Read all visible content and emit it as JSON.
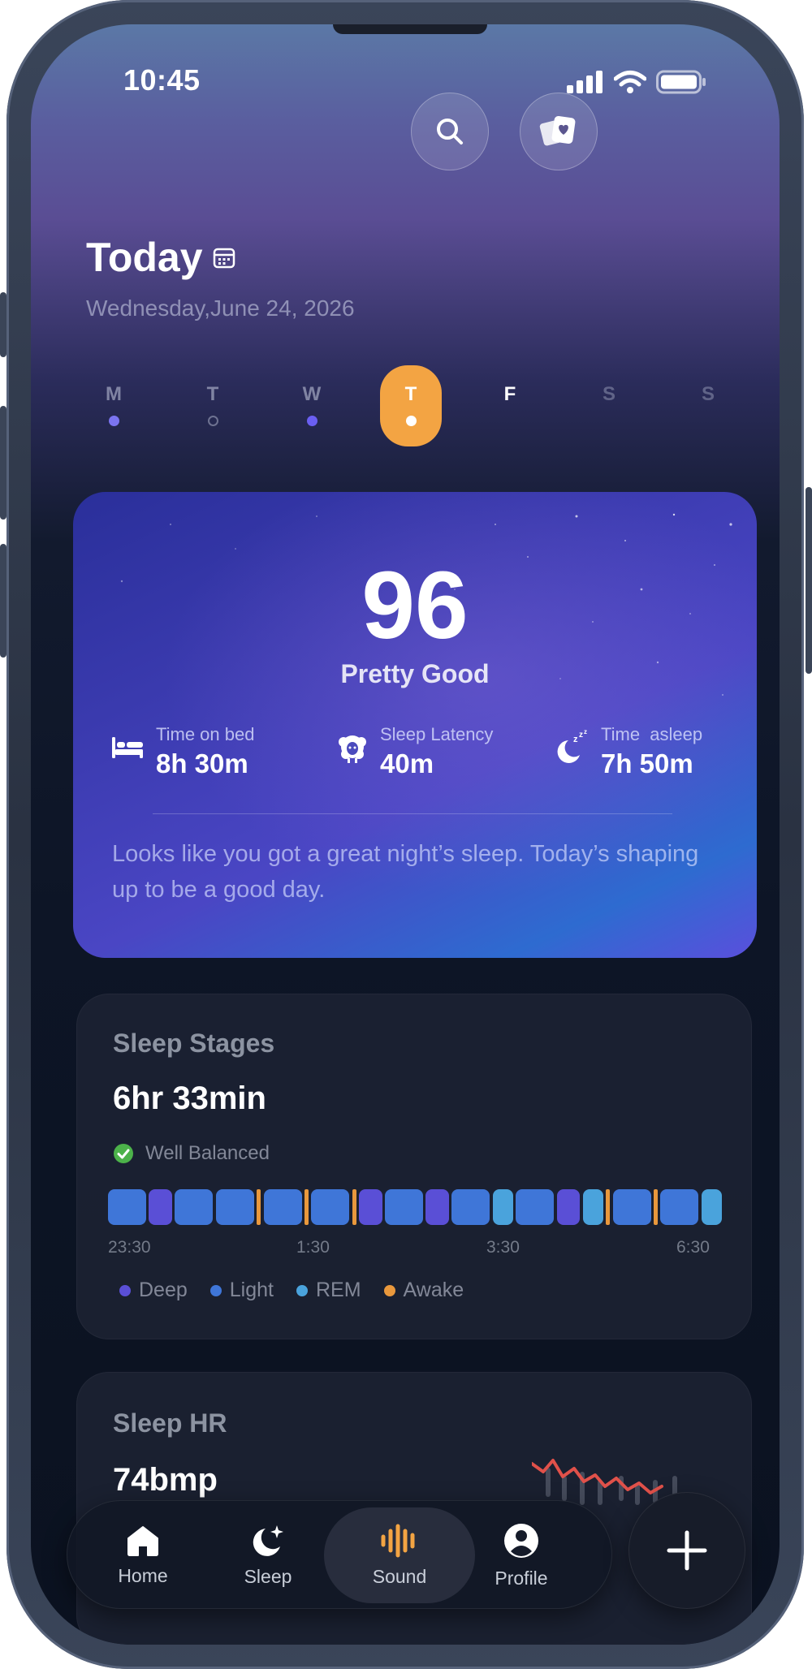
{
  "status": {
    "time": "10:45"
  },
  "header": {
    "title": "Today",
    "date": "Wednesday,June 24, 2026"
  },
  "week": [
    {
      "label": "M",
      "dot": "filled-purple"
    },
    {
      "label": "T",
      "dot": "outline"
    },
    {
      "label": "W",
      "dot": "filled-purple"
    },
    {
      "label": "T",
      "dot": "filled-white",
      "active": true
    },
    {
      "label": "F",
      "dot": "none"
    },
    {
      "label": "S",
      "dot": "none"
    },
    {
      "label": "S",
      "dot": "none"
    }
  ],
  "score_card": {
    "score": "96",
    "rating": "Pretty Good",
    "metrics": [
      {
        "label": "Time on bed",
        "value": "8h 30m",
        "icon": "bed-icon"
      },
      {
        "label": "Sleep Latency",
        "value": "40m",
        "icon": "sheep-icon"
      },
      {
        "label": "Time  asleep",
        "value": "7h 50m",
        "icon": "moon-zzz-icon"
      }
    ],
    "note": "Looks like you got a great night’s sleep. Today’s shaping up to be a good day."
  },
  "sleep_stages": {
    "title": "Sleep Stages",
    "total": "6hr 33min",
    "status": "Well Balanced",
    "ticks": [
      "23:30",
      "1:30",
      "3:30",
      "6:30"
    ],
    "legend": [
      {
        "label": "Deep",
        "color": "#5a4fd6"
      },
      {
        "label": "Light",
        "color": "#3f76d8"
      },
      {
        "label": "REM",
        "color": "#4aa3dc"
      },
      {
        "label": "Awake",
        "color": "#e9983c"
      }
    ],
    "segments": [
      "light",
      "deep",
      "light",
      "light",
      "awake",
      "light",
      "awake",
      "light",
      "awake",
      "deep",
      "light",
      "deep",
      "light",
      "rem",
      "light",
      "deep",
      "rem",
      "awake",
      "light",
      "awake",
      "light",
      "rem"
    ]
  },
  "sleep_hr": {
    "title": "Sleep HR",
    "value": "74bmp"
  },
  "nav": {
    "items": [
      {
        "label": "Home",
        "icon": "home-icon"
      },
      {
        "label": "Sleep",
        "icon": "moon-star-icon"
      },
      {
        "label": "Sound",
        "icon": "soundwave-icon",
        "active": true
      },
      {
        "label": "Profile",
        "icon": "user-icon"
      }
    ],
    "fab": "plus-icon"
  },
  "colors": {
    "accent": "#f3a443",
    "deep": "#5a4fd6",
    "light": "#3f76d8",
    "rem": "#4aa3dc",
    "awake": "#e9983c",
    "check": "#4cb24a",
    "hr_line": "#e0514a"
  }
}
